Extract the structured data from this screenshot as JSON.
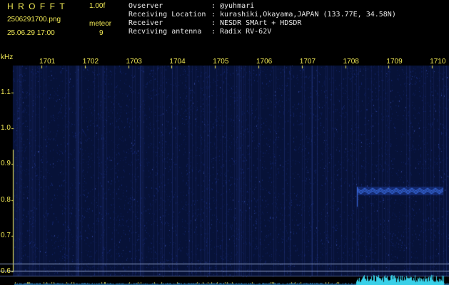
{
  "header": {
    "app_title": "HROFFT",
    "version": "1.00f",
    "file_name": "2506291700.png",
    "mode": "meteor",
    "datetime": "25.06.29 17:00",
    "count": "9"
  },
  "info": [
    {
      "key": "Ovserver",
      "value": "@yuhmari"
    },
    {
      "key": "Receiving Location",
      "value": "kurashiki,Okayama,JAPAN (133.77E, 34.58N)"
    },
    {
      "key": "Receiver",
      "value": "NESDR SMArt + HDSDR"
    },
    {
      "key": "Recviving antenna",
      "value": "Radix RV-62V"
    }
  ],
  "y_axis": {
    "unit": "kHz",
    "ticks": [
      "1.1",
      "1.0",
      "0.9",
      "0.8",
      "0.7",
      "0.6"
    ]
  },
  "x_axis": {
    "ticks": [
      "1701",
      "1702",
      "1703",
      "1704",
      "1705",
      "1706",
      "1707",
      "1708",
      "1709",
      "1710"
    ]
  },
  "colors": {
    "label_yellow": "#f2ea55",
    "text_white": "#e8e8e8",
    "background_noise": "#0a1a50",
    "signal": "#4a86ff",
    "baseline": "#8fa0c8",
    "level_trace": "#39d0e8"
  }
}
